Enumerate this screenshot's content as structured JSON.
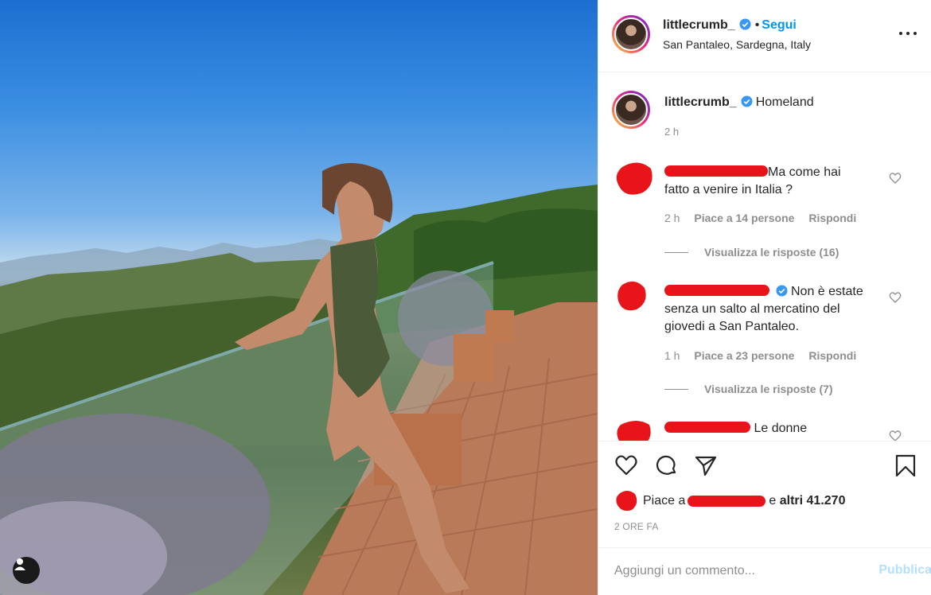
{
  "post": {
    "author": "littlecrumb_",
    "follow_label": "Segui",
    "location": "San Pantaleo, Sardegna, Italy",
    "more_icon": "more-horizontal-icon",
    "caption": "Homeland",
    "caption_time": "2 h"
  },
  "comments": [
    {
      "text_lines": [
        "Ma come hai",
        "fatto a venire in Italia ?"
      ],
      "time": "2 h",
      "likes": "Piace a 14 persone",
      "reply_label": "Rispondi",
      "view_replies": "Visualizza le risposte (16)"
    },
    {
      "text_lines": [
        "Non è estate",
        "senza un salto al mercatino del",
        "giovedi a San Pantaleo."
      ],
      "time": "1 h",
      "likes": "Piace a 23 persone",
      "reply_label": "Rispondi",
      "view_replies": "Visualizza le risposte (7)"
    },
    {
      "text_lines": [
        "Le donne"
      ]
    }
  ],
  "actions": {
    "like_icon": "heart-icon",
    "comment_icon": "comment-icon",
    "share_icon": "share-icon",
    "save_icon": "bookmark-icon"
  },
  "likes": {
    "prefix": "Piace a",
    "suffix": "e",
    "count": "altri 41.270"
  },
  "time_ago": "2 ORE FA",
  "add_comment": {
    "placeholder": "Aggiungi un commento...",
    "post_label": "Pubblica"
  },
  "colors": {
    "accent": "#0095f6",
    "redaction": "#e8141a",
    "muted": "#8e8e8e"
  }
}
